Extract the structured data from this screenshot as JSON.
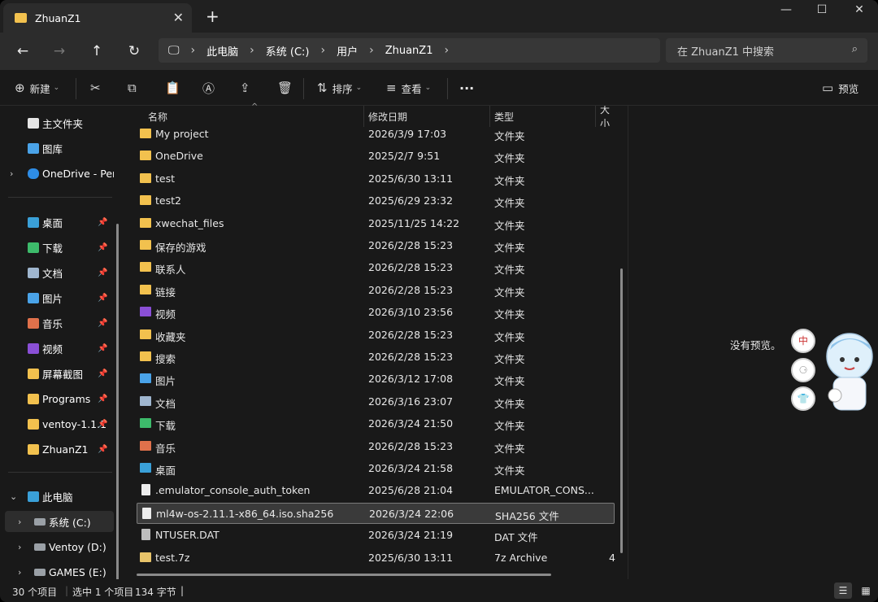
{
  "tab": {
    "title": "ZhuanZ1"
  },
  "address": {
    "crumbs": [
      "此电脑",
      "系统 (C:)",
      "用户",
      "ZhuanZ1"
    ]
  },
  "search": {
    "placeholder": "在 ZhuanZ1 中搜索"
  },
  "toolbar": {
    "new": "新建",
    "sort": "排序",
    "view": "查看",
    "more": "···",
    "preview": "预览"
  },
  "sidebar": {
    "top": [
      {
        "label": "主文件夹",
        "color": "#e6e6e6"
      },
      {
        "label": "图库",
        "color": "#4aa3e8"
      },
      {
        "label": "OneDrive - Per",
        "color": "#2e8de6"
      }
    ],
    "pinned": [
      {
        "label": "桌面",
        "color": "#3aa0d8"
      },
      {
        "label": "下载",
        "color": "#3dbb6b"
      },
      {
        "label": "文档",
        "color": "#9fb6cf"
      },
      {
        "label": "图片",
        "color": "#4aa3e8"
      },
      {
        "label": "音乐",
        "color": "#e0714b"
      },
      {
        "label": "视频",
        "color": "#8a4fd6"
      },
      {
        "label": "屏幕截图",
        "color": "#f2c14e"
      },
      {
        "label": "Programs",
        "color": "#f2c14e"
      },
      {
        "label": "ventoy-1.1.1",
        "color": "#f2c14e"
      },
      {
        "label": "ZhuanZ1",
        "color": "#f2c14e"
      }
    ],
    "pc": {
      "label": "此电脑"
    },
    "drives": [
      {
        "label": "系统 (C:)"
      },
      {
        "label": "Ventoy (D:)"
      },
      {
        "label": "GAMES (E:)"
      }
    ]
  },
  "columns": {
    "name": "名称",
    "date": "修改日期",
    "type": "类型",
    "size": "大小"
  },
  "files": [
    {
      "name": "My project",
      "date": "2026/3/9 17:03",
      "type": "文件夹",
      "icon": "folder",
      "color": "#f2c14e"
    },
    {
      "name": "OneDrive",
      "date": "2025/2/7 9:51",
      "type": "文件夹",
      "icon": "folder",
      "color": "#f2c14e"
    },
    {
      "name": "test",
      "date": "2025/6/30 13:11",
      "type": "文件夹",
      "icon": "folder",
      "color": "#f2c14e"
    },
    {
      "name": "test2",
      "date": "2025/6/29 23:32",
      "type": "文件夹",
      "icon": "folder",
      "color": "#f2c14e"
    },
    {
      "name": "xwechat_files",
      "date": "2025/11/25 14:22",
      "type": "文件夹",
      "icon": "folder",
      "color": "#f2c14e"
    },
    {
      "name": "保存的游戏",
      "date": "2026/2/28 15:23",
      "type": "文件夹",
      "icon": "folder",
      "color": "#f2c14e"
    },
    {
      "name": "联系人",
      "date": "2026/2/28 15:23",
      "type": "文件夹",
      "icon": "folder",
      "color": "#f2c14e"
    },
    {
      "name": "链接",
      "date": "2026/2/28 15:23",
      "type": "文件夹",
      "icon": "folder",
      "color": "#f2c14e"
    },
    {
      "name": "视频",
      "date": "2026/3/10 23:56",
      "type": "文件夹",
      "icon": "video",
      "color": "#8a4fd6"
    },
    {
      "name": "收藏夹",
      "date": "2026/2/28 15:23",
      "type": "文件夹",
      "icon": "folder",
      "color": "#f2c14e"
    },
    {
      "name": "搜索",
      "date": "2026/2/28 15:23",
      "type": "文件夹",
      "icon": "folder",
      "color": "#f2c14e"
    },
    {
      "name": "图片",
      "date": "2026/3/12 17:08",
      "type": "文件夹",
      "icon": "pictures",
      "color": "#4aa3e8"
    },
    {
      "name": "文档",
      "date": "2026/3/16 23:07",
      "type": "文件夹",
      "icon": "documents",
      "color": "#9fb6cf"
    },
    {
      "name": "下载",
      "date": "2026/3/24 21:50",
      "type": "文件夹",
      "icon": "downloads",
      "color": "#3dbb6b"
    },
    {
      "name": "音乐",
      "date": "2026/2/28 15:23",
      "type": "文件夹",
      "icon": "music",
      "color": "#e0714b"
    },
    {
      "name": "桌面",
      "date": "2026/3/24 21:58",
      "type": "文件夹",
      "icon": "desktop",
      "color": "#3aa0d8"
    },
    {
      "name": ".emulator_console_auth_token",
      "date": "2025/6/28 21:04",
      "type": "EMULATOR_CONS...",
      "icon": "file",
      "color": "#ededed"
    },
    {
      "name": "ml4w-os-2.11.1-x86_64.iso.sha256",
      "date": "2026/3/24 22:06",
      "type": "SHA256 文件",
      "icon": "file",
      "color": "#ededed",
      "selected": true
    },
    {
      "name": "NTUSER.DAT",
      "date": "2026/3/24 21:19",
      "type": "DAT 文件",
      "icon": "file",
      "color": "#bdbdbd"
    },
    {
      "name": "test.7z",
      "date": "2025/6/30 13:11",
      "type": "7z Archive",
      "icon": "archive",
      "color": "#e8c46a",
      "size": "4"
    }
  ],
  "preview": {
    "empty_text": "没有预览。"
  },
  "status": {
    "count": "30 个项目",
    "selection": "选中 1 个项目",
    "size": "134 字节"
  }
}
